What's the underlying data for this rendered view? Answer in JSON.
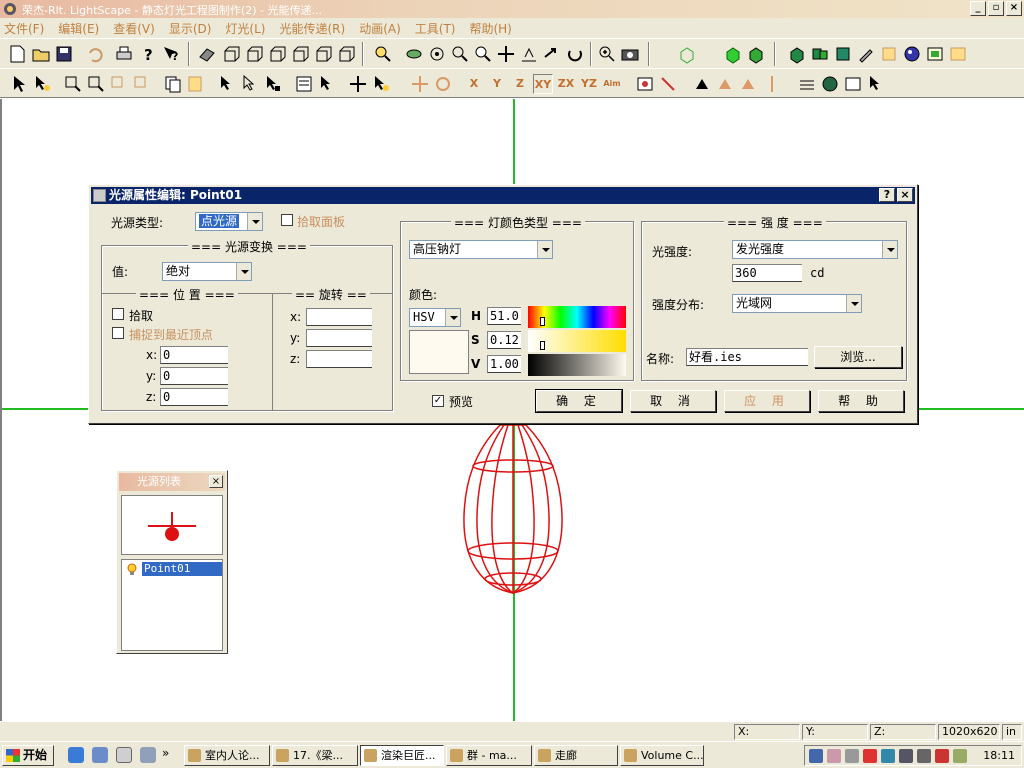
{
  "window": {
    "title": "荣杰-Rlt. LightScape - 静态灯光工程图制作(2) - 光能传递..."
  },
  "menu": [
    "文件(F)",
    "编辑(E)",
    "查看(V)",
    "显示(D)",
    "灯光(L)",
    "光能传递(R)",
    "动画(A)",
    "工具(T)",
    "帮助(H)"
  ],
  "toolbar": {
    "axes": [
      "X",
      "Y",
      "Z",
      "XY",
      "ZX",
      "YZ",
      "Aim"
    ]
  },
  "dialog": {
    "title": "光源属性编辑: Point01",
    "source_type_label": "光源类型:",
    "source_type_value": "点光源",
    "pick_panel_label": "拾取面板",
    "transform_group": "=== 光源变换 ===",
    "value_label": "值:",
    "value_option": "绝对",
    "position_group": "=== 位 置 ===",
    "pick_label": "拾取",
    "snap_label": "捕捉到最近顶点",
    "pos": {
      "x_label": "x:",
      "y_label": "y:",
      "z_label": "z:",
      "x": "0",
      "y": "0",
      "z": "0"
    },
    "rotation_group": "== 旋转 ==",
    "rot": {
      "x_label": "x:",
      "y_label": "y:",
      "z_label": "z:"
    },
    "color_group": "=== 灯颜色类型 ===",
    "lamp_type": "高压钠灯",
    "color_label": "颜色:",
    "color_model": "HSV",
    "h_label": "H",
    "h_value": "51.0",
    "s_label": "S",
    "s_value": "0.12",
    "v_label": "V",
    "v_value": "1.00",
    "intensity_group": "=== 强 度 ===",
    "intensity_label": "光强度:",
    "intensity_value": "发光强度",
    "intensity_number": "360",
    "intensity_unit": "cd",
    "distribution_label": "强度分布:",
    "distribution_value": "光域网",
    "name_label": "名称:",
    "name_value": "好看.ies",
    "browse_button": "浏览...",
    "preview_label": "预览",
    "ok_button": "确 定",
    "cancel_button": "取 消",
    "apply_button": "应 用",
    "help_button": "帮 助"
  },
  "light_panel": {
    "title": "光源列表",
    "item": "Point01"
  },
  "statusbar": {
    "x": "X:",
    "y": "Y:",
    "z": "Z:",
    "size": "1020x620",
    "unit": "in"
  },
  "taskbar": {
    "start": "开始",
    "tasks": [
      "室内人论...",
      "17.《梁...",
      "渲染巨匠...",
      "群 - ma...",
      "走廊",
      "Volume C..."
    ],
    "clock": "18:11"
  },
  "colors": {
    "axis_green": "#22bb22",
    "wireframe_red": "#dd1111",
    "selection_blue": "#316ac5",
    "dialog_title_bg": "#0a246a"
  }
}
